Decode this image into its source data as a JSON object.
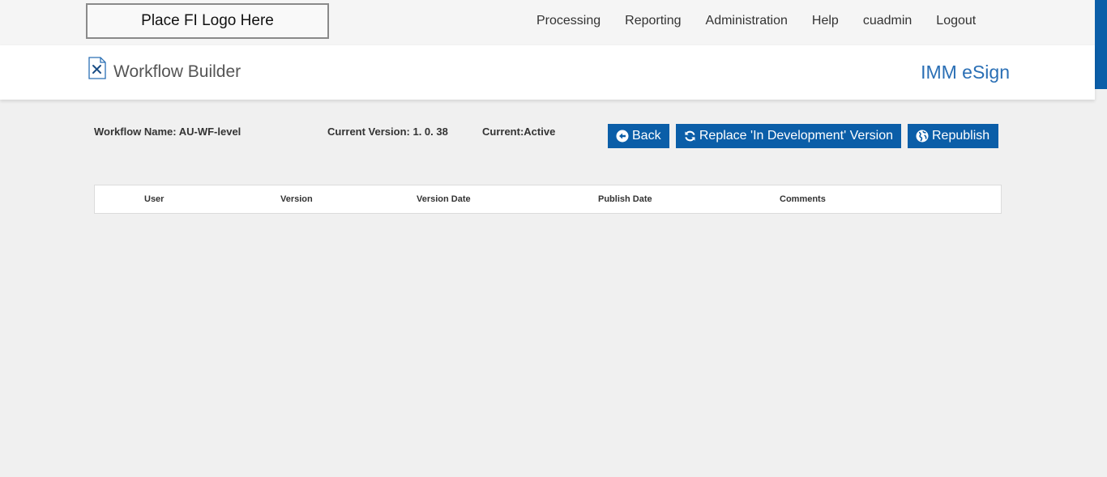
{
  "header": {
    "logo_text": "Place FI Logo Here",
    "nav": [
      "Processing",
      "Reporting",
      "Administration",
      "Help",
      "cuadmin",
      "Logout"
    ]
  },
  "titlebar": {
    "title": "Workflow Builder",
    "brand": "IMM eSign",
    "title_icon": "document-tools-icon"
  },
  "info": {
    "workflow_name": "Workflow Name: AU-WF-level",
    "current_version": "Current Version: 1. 0. 38",
    "current_status": "Current:Active"
  },
  "buttons": {
    "back": "Back",
    "replace": "Replace 'In Development' Version",
    "republish": "Republish"
  },
  "table": {
    "columns": [
      "User",
      "Version",
      "Version Date",
      "Publish Date",
      "Comments"
    ]
  },
  "colors": {
    "primary": "#0b5ea8",
    "brand": "#2a6fb5",
    "background": "#f0f0f0"
  }
}
